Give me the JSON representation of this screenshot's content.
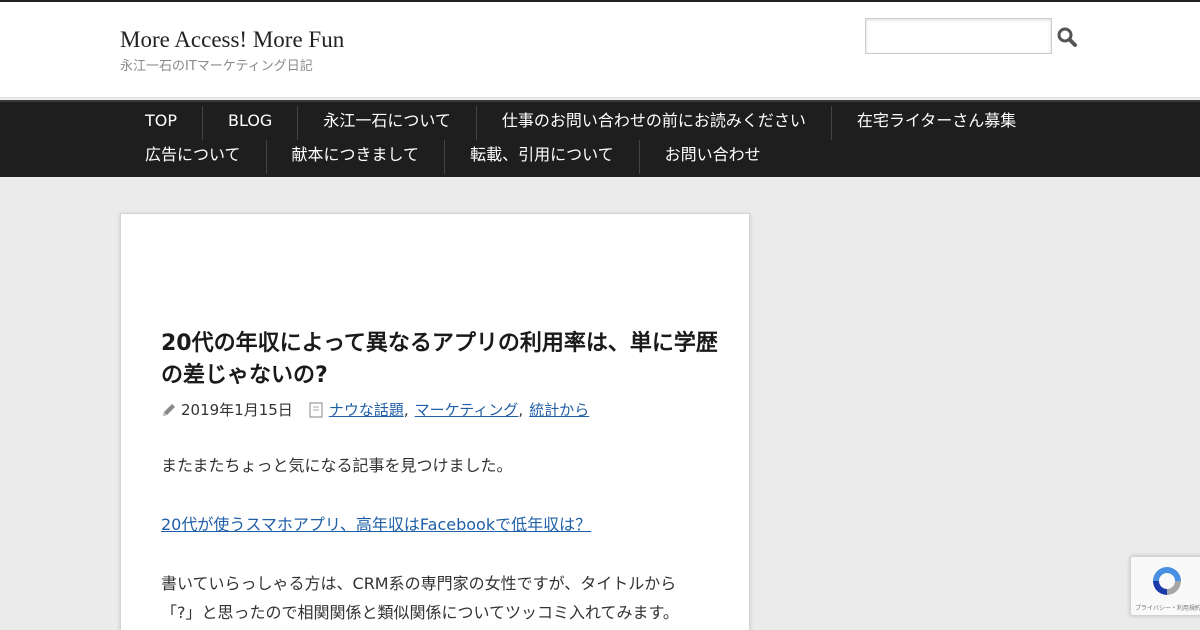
{
  "header": {
    "site_title": "More Access! More Fun",
    "site_description": "永江一石のITマーケティング日記",
    "search": {
      "value": "",
      "placeholder": ""
    }
  },
  "nav": {
    "row1": [
      "TOP",
      "BLOG",
      "永江一石について",
      "仕事のお問い合わせの前にお読みください",
      "在宅ライターさん募集"
    ],
    "row2": [
      "広告について",
      "献本につきまして",
      "転載、引用について",
      "お問い合わせ"
    ]
  },
  "post": {
    "title": "20代の年収によって異なるアプリの利用率は、単に学歴の差じゃないの?",
    "date": "2019年1月15日",
    "categories": [
      "ナウな話題",
      "マーケティング",
      "統計から"
    ],
    "paragraph1": "またまたちょっと気になる記事を見つけました。",
    "link_text": "20代が使うスマホアプリ、高年収はFacebookで低年収は？",
    "paragraph2": "書いていらっしゃる方は、CRM系の専門家の女性ですが、タイトルから「?」と思ったので相関関係と類似関係についてツッコミ入れてみます。"
  },
  "recaptcha": {
    "text": "プライバシー・利用規約"
  },
  "icons": {
    "search": "search-icon",
    "date": "pencil-icon",
    "category": "folder-icon",
    "captcha": "recaptcha-logo-icon"
  },
  "colors": {
    "nav_bg": "#1e1e1e",
    "link": "#1f5fa8",
    "page_bg": "#ebebeb"
  }
}
